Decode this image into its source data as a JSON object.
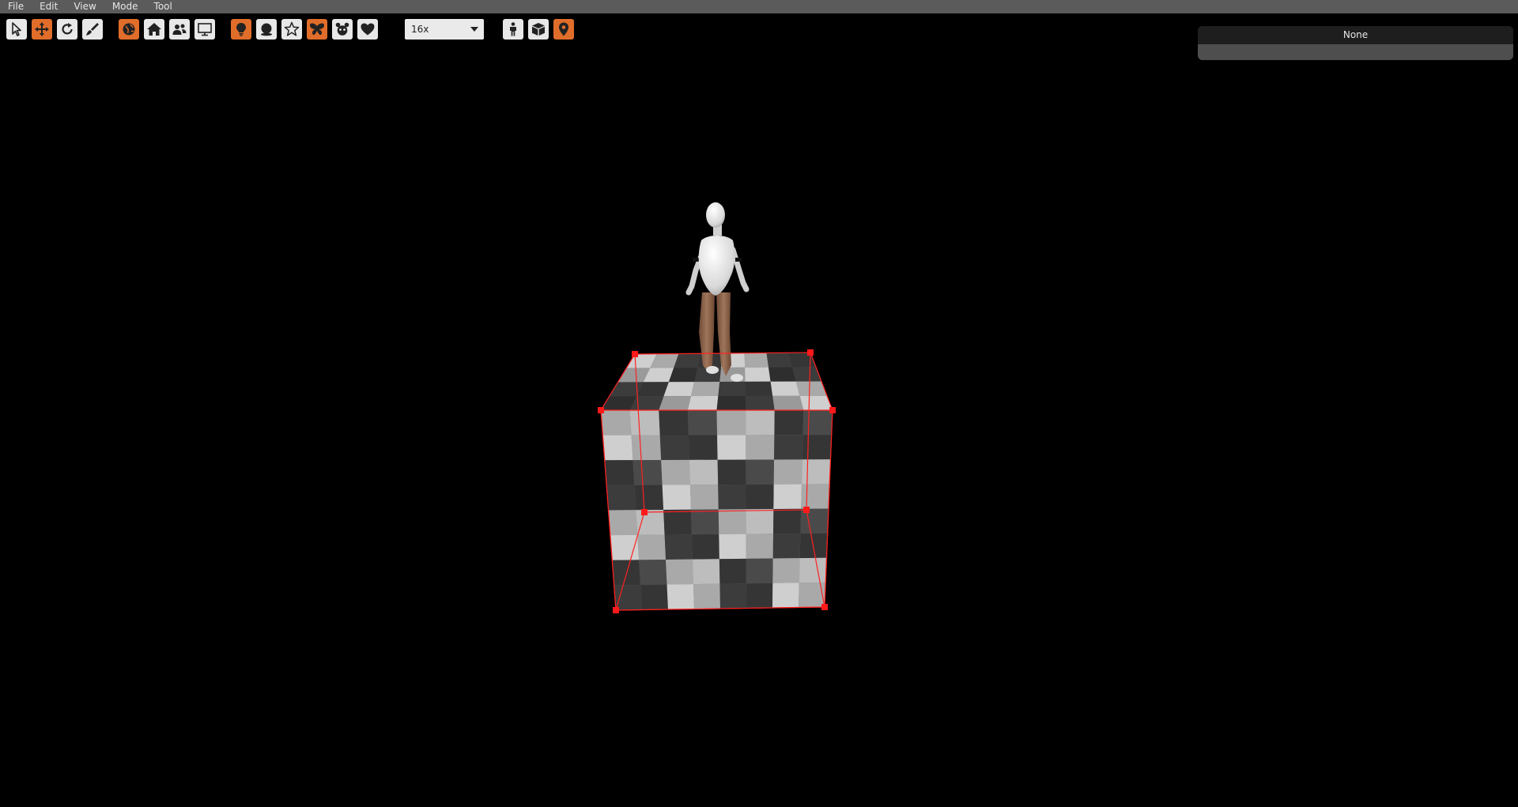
{
  "menubar": {
    "items": [
      "File",
      "Edit",
      "View",
      "Mode",
      "Tool"
    ]
  },
  "toolbar": {
    "zoom": {
      "value": "16x"
    }
  },
  "panel": {
    "selection": "None"
  },
  "icons": {
    "select": "cursor-arrow-icon",
    "move": "move-arrows-icon",
    "rotate": "rotate-icon",
    "paint": "brush-icon",
    "globe": "globe-icon",
    "home": "home-icon",
    "people": "people-icon",
    "display": "monitor-icon",
    "light": "lightbulb-icon",
    "sphere": "sphere-icon",
    "star": "star-icon",
    "butterfly": "butterfly-icon",
    "mask": "mask-icon",
    "heart": "heart-icon",
    "figure": "figure-icon",
    "box": "box-icon",
    "pin": "location-pin-icon"
  },
  "colors": {
    "accent": "#e06d2a",
    "selection": "#ff1a1a",
    "menubar": "#5b5b5b",
    "background": "#000000"
  }
}
